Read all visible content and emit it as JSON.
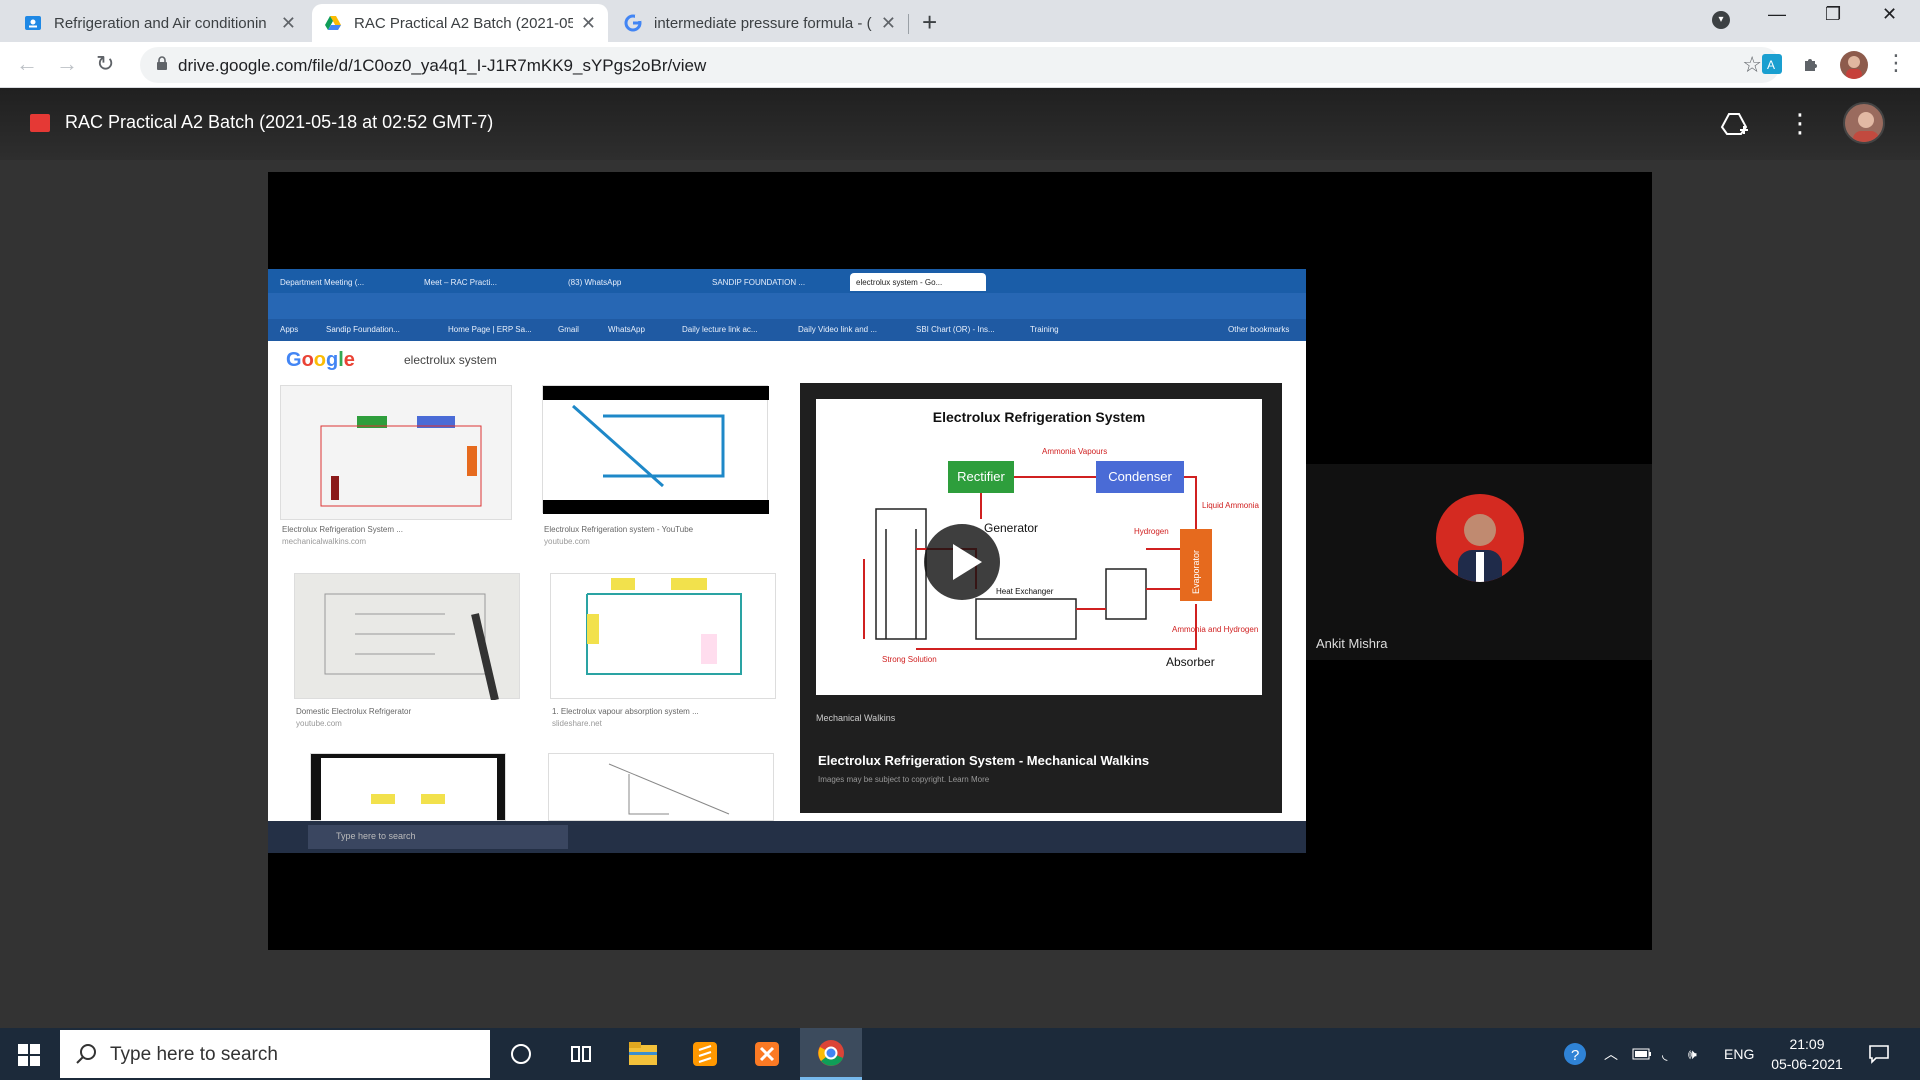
{
  "browser": {
    "tabs": [
      {
        "title": "Refrigeration and Air conditionin",
        "active": false
      },
      {
        "title": "RAC Practical A2 Batch (2021-05-",
        "active": true
      },
      {
        "title": "intermediate pressure formula - (",
        "active": false
      }
    ],
    "url": "drive.google.com/file/d/1C0oz0_ya4q1_I-J1R7mKK9_sYPgs2oBr/view"
  },
  "viewer": {
    "file_title": "RAC Practical A2 Batch (2021-05-18 at 02:52 GMT-7)"
  },
  "video": {
    "shared_screen": {
      "tabs": [
        "Department Meeting (...",
        "Meet – RAC Practi...",
        "(83) WhatsApp",
        "SANDIP FOUNDATION ...",
        "electrolux system - Go..."
      ],
      "bookmarks": [
        "Apps",
        "Sandip Foundation...",
        "Home Page | ERP Sa...",
        "Gmail",
        "WhatsApp",
        "Daily lecture link ac...",
        "Daily Video link and ...",
        "SBI Chart (OR) - Ins...",
        "Training",
        "Other bookmarks"
      ],
      "search_logo": "Google",
      "search_query": "electrolux system",
      "results": [
        {
          "caption": "Electrolux Refrigeration System ...",
          "source": "mechanicalwalkins.com"
        },
        {
          "caption": "Electrolux Refrigeration system - YouTube",
          "source": "youtube.com"
        },
        {
          "caption": "Domestic Electrolux Refrigerator",
          "source": "youtube.com"
        },
        {
          "caption": "1. Electrolux vapour absorption system ...",
          "source": "slideshare.net"
        }
      ],
      "preview": {
        "title": "Electrolux Refrigeration System",
        "labels": {
          "rectifier": "Rectifier",
          "condenser": "Condenser",
          "generator": "Generator",
          "heat_exchanger": "Heat Exchanger",
          "absorber": "Absorber",
          "ammonia_vapours": "Ammonia Vapours",
          "liquid_ammonia": "Liquid Ammonia",
          "hydrogen": "Hydrogen",
          "evaporator": "Evaporator",
          "ammonia_hydrogen": "Ammonia and Hydrogen",
          "strong_solution": "Strong Solution"
        },
        "source": "Mechanical Walkins",
        "caption": "Electrolux Refrigeration System - Mechanical Walkins",
        "subcaption": "Images may be subject to copyright. Learn More"
      },
      "taskbar_search": "Type here to search"
    },
    "participant_name": "Ankit Mishra"
  },
  "taskbar": {
    "search_placeholder": "Type here to search",
    "language": "ENG",
    "time": "21:09",
    "date": "05-06-2021"
  }
}
